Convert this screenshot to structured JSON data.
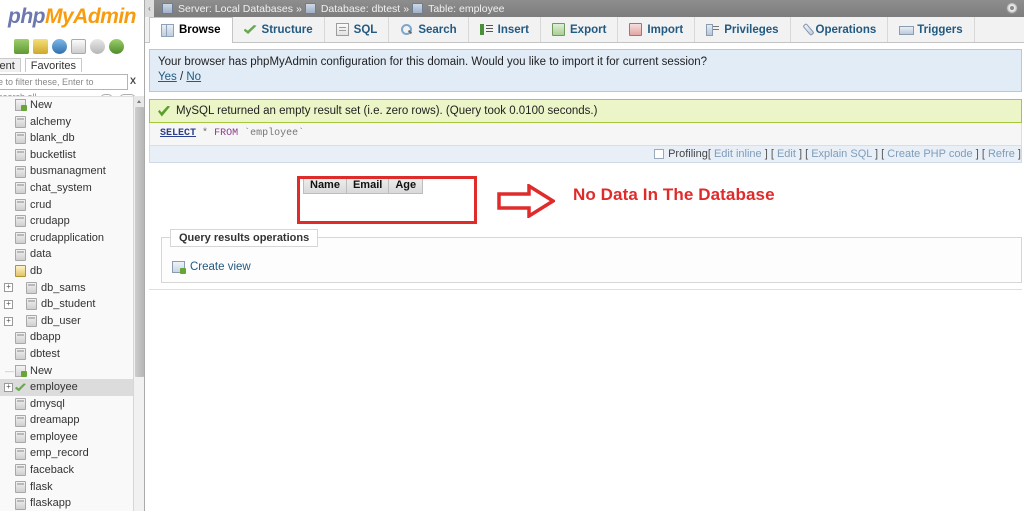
{
  "brand": {
    "php": "php",
    "my": "My",
    "admin": "Admin",
    "icons": [
      "home-icon",
      "sql-query-icon",
      "help-icon",
      "documentation-icon",
      "wiki-icon",
      "refresh-icon"
    ]
  },
  "sidebar": {
    "tabs": [
      {
        "label": "cent",
        "name": "recent"
      },
      {
        "label": "Favorites",
        "name": "favorites"
      }
    ],
    "filter": {
      "placeholder": "e to filter these, Enter to search all",
      "value": "",
      "clear_label": "X"
    },
    "tree": [
      {
        "label": "New",
        "icon": "new-db-icon",
        "expand": false,
        "indent": 0,
        "selected": false
      },
      {
        "label": "alchemy",
        "icon": "db-icon",
        "expand": false,
        "indent": 0,
        "selected": false
      },
      {
        "label": "blank_db",
        "icon": "db-icon",
        "expand": false,
        "indent": 0,
        "selected": false
      },
      {
        "label": "bucketlist",
        "icon": "db-icon",
        "expand": false,
        "indent": 0,
        "selected": false
      },
      {
        "label": "busmanagment",
        "icon": "db-icon",
        "expand": false,
        "indent": 0,
        "selected": false
      },
      {
        "label": "chat_system",
        "icon": "db-icon",
        "expand": false,
        "indent": 0,
        "selected": false
      },
      {
        "label": "crud",
        "icon": "db-icon",
        "expand": false,
        "indent": 0,
        "selected": false
      },
      {
        "label": "crudapp",
        "icon": "db-icon",
        "expand": false,
        "indent": 0,
        "selected": false
      },
      {
        "label": "crudapplication",
        "icon": "db-icon",
        "expand": false,
        "indent": 0,
        "selected": false
      },
      {
        "label": "data",
        "icon": "db-icon",
        "expand": false,
        "indent": 0,
        "selected": false
      },
      {
        "label": "db",
        "icon": "db-open-icon",
        "expand": false,
        "indent": 0,
        "selected": false
      },
      {
        "label": "db_sams",
        "icon": "db-icon",
        "expand": true,
        "indent": 1,
        "selected": false
      },
      {
        "label": "db_student",
        "icon": "db-icon",
        "expand": true,
        "indent": 1,
        "selected": false
      },
      {
        "label": "db_user",
        "icon": "db-icon",
        "expand": true,
        "indent": 1,
        "selected": false
      },
      {
        "label": "dbapp",
        "icon": "db-icon",
        "expand": false,
        "indent": 0,
        "selected": false
      },
      {
        "label": "dbtest",
        "icon": "db-icon",
        "expand": false,
        "indent": 0,
        "selected": false
      },
      {
        "label": "New",
        "icon": "new-table-icon",
        "expand": false,
        "indent": 1,
        "selected": false
      },
      {
        "label": "employee",
        "icon": "table-selected-icon",
        "expand": true,
        "indent": 0,
        "selected": true
      },
      {
        "label": "dmysql",
        "icon": "db-icon",
        "expand": false,
        "indent": 0,
        "selected": false
      },
      {
        "label": "dreamapp",
        "icon": "db-icon",
        "expand": false,
        "indent": 0,
        "selected": false
      },
      {
        "label": "employee",
        "icon": "db-icon",
        "expand": false,
        "indent": 0,
        "selected": false
      },
      {
        "label": "emp_record",
        "icon": "db-icon",
        "expand": false,
        "indent": 0,
        "selected": false
      },
      {
        "label": "faceback",
        "icon": "db-icon",
        "expand": false,
        "indent": 0,
        "selected": false
      },
      {
        "label": "flask",
        "icon": "db-icon",
        "expand": false,
        "indent": 0,
        "selected": false
      },
      {
        "label": "flaskapp",
        "icon": "db-icon",
        "expand": false,
        "indent": 0,
        "selected": false
      }
    ]
  },
  "breadcrumb": {
    "server_label": "Server: Local Databases",
    "sep1": "»",
    "database_label": "Database: dbtest",
    "sep2": "»",
    "table_label": "Table: employee"
  },
  "tabs": [
    {
      "label": "Browse",
      "icon": "browse-icon",
      "active": true
    },
    {
      "label": "Structure",
      "icon": "structure-icon",
      "active": false
    },
    {
      "label": "SQL",
      "icon": "sql-icon",
      "active": false
    },
    {
      "label": "Search",
      "icon": "search-icon",
      "active": false
    },
    {
      "label": "Insert",
      "icon": "insert-icon",
      "active": false
    },
    {
      "label": "Export",
      "icon": "export-icon",
      "active": false
    },
    {
      "label": "Import",
      "icon": "import-icon",
      "active": false
    },
    {
      "label": "Privileges",
      "icon": "privileges-icon",
      "active": false
    },
    {
      "label": "Operations",
      "icon": "operations-icon",
      "active": false
    },
    {
      "label": "Triggers",
      "icon": "triggers-icon",
      "active": false
    }
  ],
  "notice": {
    "text": "Your browser has phpMyAdmin configuration for this domain. Would you like to import it for current session?",
    "yes": "Yes",
    "slash": "/",
    "no": "No"
  },
  "success": {
    "message": "MySQL returned an empty result set (i.e. zero rows).  (Query took 0.0100 seconds.)"
  },
  "sql": {
    "keyword": "SELECT",
    "star": "*",
    "from": "FROM",
    "table": "`employee`"
  },
  "profiling": {
    "label": "Profiling",
    "links": [
      "Edit inline",
      "Edit",
      "Explain SQL",
      "Create PHP code",
      "Refre"
    ]
  },
  "results": {
    "columns": [
      "Name",
      "Email",
      "Age"
    ],
    "rows": []
  },
  "annotation": {
    "text": "No Data In The Database",
    "color": "#e02b2b"
  },
  "query_results_operations": {
    "legend": "Query results operations",
    "create_view": "Create view"
  }
}
